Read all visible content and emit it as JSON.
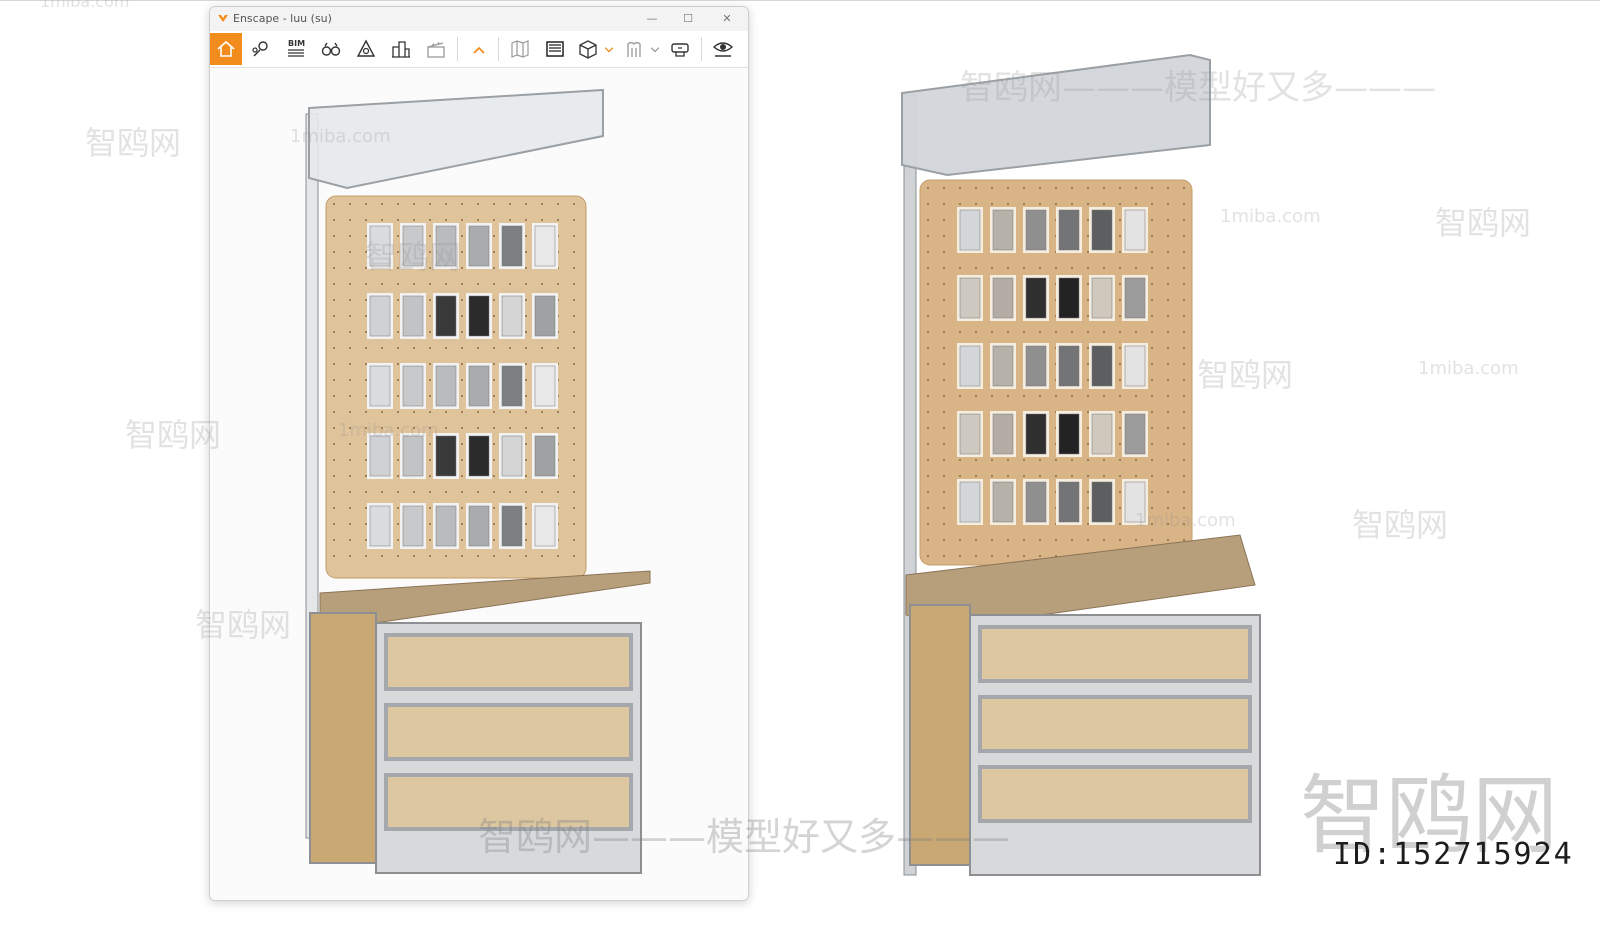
{
  "window": {
    "title": "Enscape - luu (su)",
    "controls": {
      "minimize": "—",
      "maximize": "☐",
      "close": "✕"
    }
  },
  "toolbar": {
    "accent_color": "#f28c1c",
    "items": [
      {
        "icon": "home-icon",
        "active": true
      },
      {
        "icon": "pin-icon"
      },
      {
        "icon": "bim-icon",
        "label": "BIM"
      },
      {
        "icon": "binoculars-icon"
      },
      {
        "icon": "asset-library-icon"
      },
      {
        "icon": "buildings-icon"
      },
      {
        "icon": "clapper-icon"
      },
      {
        "icon": "chevron-up-icon"
      },
      {
        "icon": "map-icon"
      },
      {
        "icon": "render-image-icon"
      },
      {
        "icon": "cube-icon"
      },
      {
        "icon": "walk-icon"
      },
      {
        "icon": "vr-icon"
      },
      {
        "icon": "eye-settings-icon"
      }
    ]
  },
  "watermarks": {
    "site": "1miba.com",
    "brand": "智鸥网",
    "slogan": "智鸥网———模型好又多———",
    "big_brand": "智鸥网",
    "id_label": "ID:152715924"
  }
}
